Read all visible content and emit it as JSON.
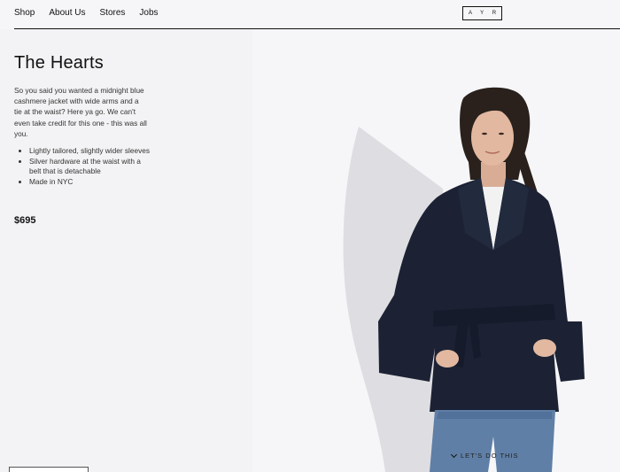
{
  "nav": {
    "links": [
      "Shop",
      "About Us",
      "Stores",
      "Jobs"
    ],
    "logo": "A Y R"
  },
  "product": {
    "title": "The Hearts",
    "description": "So you said you wanted a midnight blue cashmere jacket with wide arms and a tie at the waist? Here ya go. We can't even take credit for this one - this was all you.",
    "features": [
      "Lightly tailored, slightly wider sleeves",
      "Silver hardware at the waist with a belt that is detachable",
      "Made in NYC"
    ],
    "price": "$695"
  },
  "hero": {
    "cta_label": "LET'S DO THIS",
    "colors": {
      "jacket": "#1c2234",
      "jeans": "#5f7fa6",
      "skin": "#e2b8a0",
      "hair": "#2a211c",
      "shadow": "#dcdce0"
    }
  }
}
